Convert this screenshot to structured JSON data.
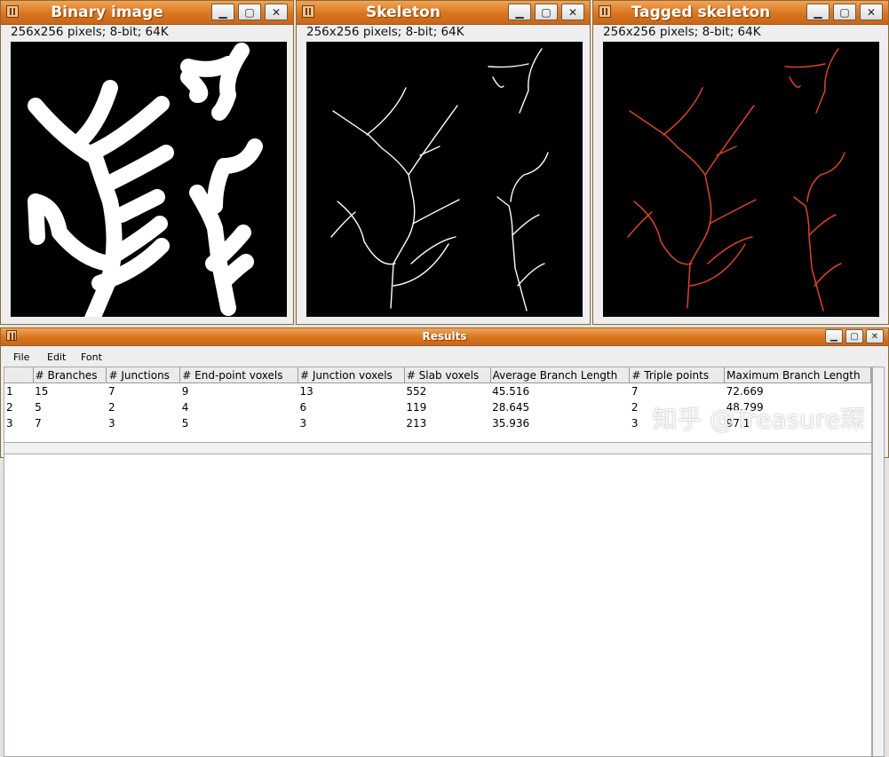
{
  "windows": [
    {
      "title": "Binary image",
      "info": "256x256 pixels; 8-bit; 64K"
    },
    {
      "title": "Skeleton",
      "info": "256x256 pixels; 8-bit; 64K"
    },
    {
      "title": "Tagged skeleton",
      "info": "256x256 pixels; 8-bit; 64K"
    }
  ],
  "window_buttons": {
    "minimize": "▁",
    "maximize": "▢",
    "close": "✕"
  },
  "results": {
    "title": "Results",
    "menu": [
      "File",
      "Edit",
      "Font"
    ],
    "columns": [
      "",
      "# Branches",
      "# Junctions",
      "# End-point voxels",
      "# Junction voxels",
      "# Slab voxels",
      "Average Branch Length",
      "# Triple points",
      "Maximum Branch Length"
    ],
    "rows": [
      [
        "1",
        "15",
        "7",
        "9",
        "13",
        "552",
        "45.516",
        "7",
        "72.669"
      ],
      [
        "2",
        "5",
        "2",
        "4",
        "6",
        "119",
        "28.645",
        "2",
        "48.799"
      ],
      [
        "3",
        "7",
        "3",
        "5",
        "3",
        "213",
        "35.936",
        "3",
        "97.1"
      ]
    ]
  },
  "watermark": "知乎 @Treasure琛",
  "colors": {
    "titlebar": "#d9751e",
    "tagged_branch": "#d9442c",
    "skeleton": "#ffffff",
    "binary": "#ffffff"
  }
}
